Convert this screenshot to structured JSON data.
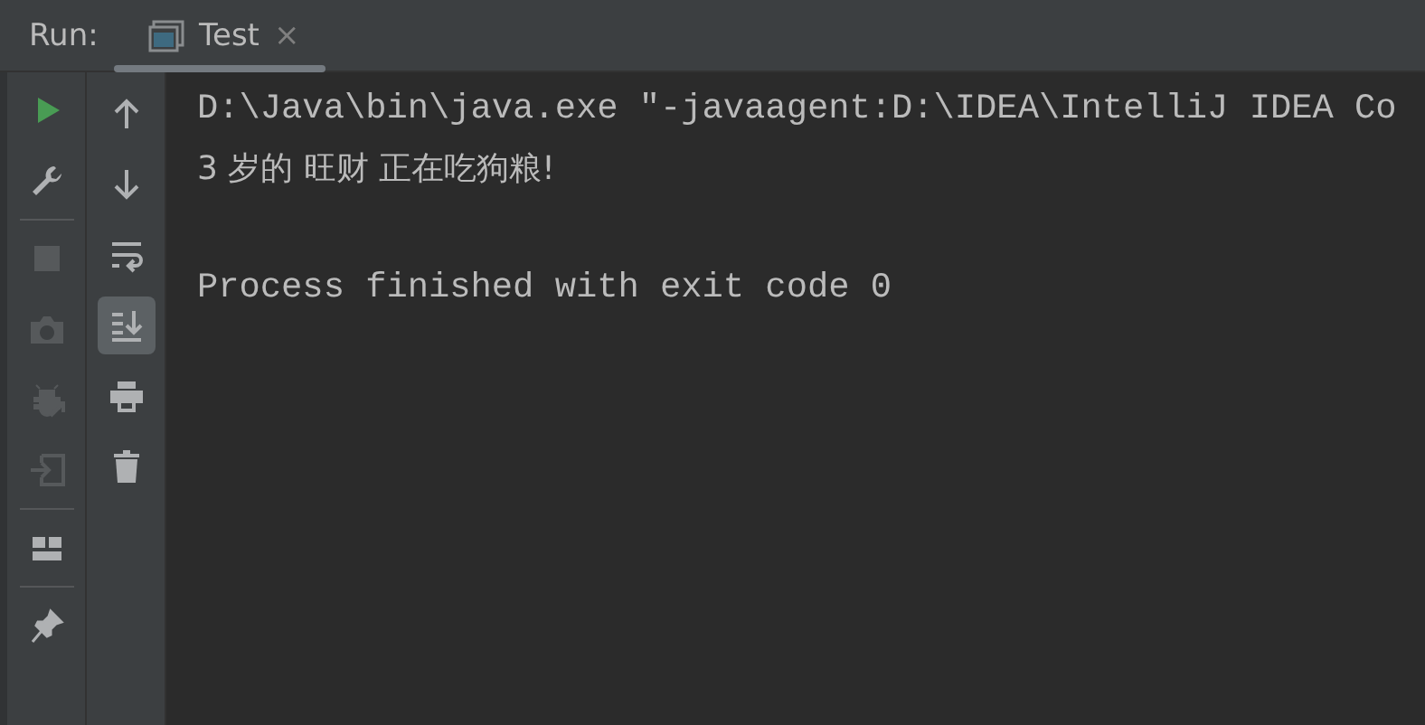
{
  "header": {
    "label": "Run:",
    "tabs": [
      {
        "title": "Test",
        "selected": true,
        "close": "×"
      }
    ]
  },
  "left_toolbar": [
    {
      "kind": "button",
      "disabled": false
    },
    {
      "kind": "button",
      "disabled": false
    },
    {
      "kind": "separator"
    },
    {
      "kind": "button",
      "disabled": true
    },
    {
      "kind": "button",
      "disabled": true
    },
    {
      "kind": "button",
      "disabled": true
    },
    {
      "kind": "button",
      "disabled": true
    },
    {
      "kind": "separator"
    },
    {
      "kind": "button",
      "disabled": false
    },
    {
      "kind": "separator"
    },
    {
      "kind": "button",
      "disabled": false
    }
  ],
  "console_toolbar": [
    {
      "kind": "button",
      "on": false
    },
    {
      "kind": "button",
      "on": false
    },
    {
      "kind": "button",
      "on": false
    },
    {
      "kind": "button",
      "on": true
    },
    {
      "kind": "button",
      "on": false
    },
    {
      "kind": "button",
      "on": false
    }
  ],
  "console": {
    "blocks": [
      [
        "D:\\Java\\bin\\java.exe \"-javaagent:D:\\IDEA\\IntelliJ IDEA Co",
        "3 岁的 旺财 正在吃狗粮!"
      ],
      [
        "Process finished with exit code 0"
      ]
    ]
  }
}
